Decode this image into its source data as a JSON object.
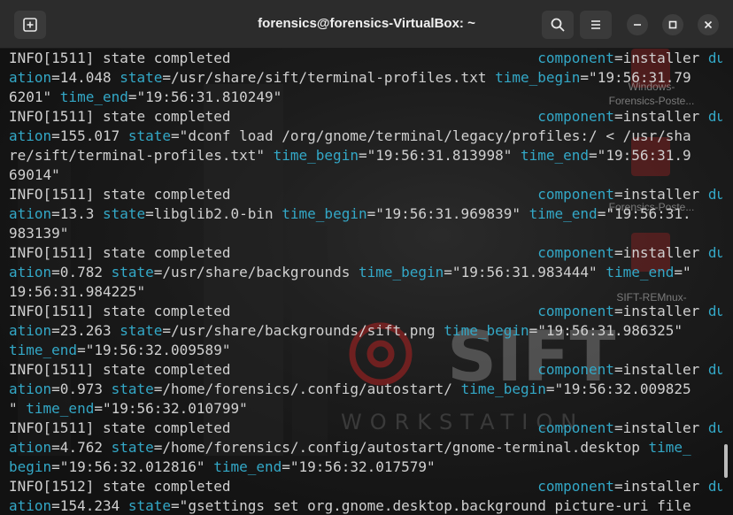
{
  "window": {
    "title": "forensics@forensics-VirtualBox: ~",
    "new_tab_icon": "new-tab-icon",
    "search_icon": "search-icon",
    "menu_icon": "hamburger-menu-icon",
    "minimize_icon": "minimize-icon",
    "maximize_icon": "maximize-icon",
    "close_icon": "close-icon"
  },
  "desktop": {
    "logo_text": "SIFT",
    "logo_subtext": "WORKSTATION",
    "icons": [
      {
        "label": "Windows-"
      },
      {
        "label": "Forensics-Poste..."
      },
      {
        "label": "Forensics-Poste..."
      },
      {
        "label": "SIFT-REMnux-"
      }
    ]
  },
  "colors": {
    "key": "#33a8c7",
    "text": "#d0d0d0",
    "titlebar": "#2c2c2c"
  },
  "terminal": {
    "lines": [
      {
        "segs": [
          [
            "s",
            "INFO[1511] state completed                                    "
          ],
          [
            "c",
            "component"
          ],
          [
            "s",
            "=installer "
          ],
          [
            "c",
            "dur"
          ]
        ]
      },
      {
        "segs": [
          [
            "c",
            "ation"
          ],
          [
            "s",
            "=14.048 "
          ],
          [
            "c",
            "state"
          ],
          [
            "s",
            "=/usr/share/sift/terminal-profiles.txt "
          ],
          [
            "c",
            "time_begin"
          ],
          [
            "s",
            "=\"19:56:31.79"
          ]
        ]
      },
      {
        "segs": [
          [
            "s",
            "6201\" "
          ],
          [
            "c",
            "time_end"
          ],
          [
            "s",
            "=\"19:56:31.810249\""
          ]
        ]
      },
      {
        "segs": [
          [
            "s",
            "INFO[1511] state completed                                    "
          ],
          [
            "c",
            "component"
          ],
          [
            "s",
            "=installer "
          ],
          [
            "c",
            "dur"
          ]
        ]
      },
      {
        "segs": [
          [
            "c",
            "ation"
          ],
          [
            "s",
            "=155.017 "
          ],
          [
            "c",
            "state"
          ],
          [
            "s",
            "=\"dconf load /org/gnome/terminal/legacy/profiles:/ < /usr/sha"
          ]
        ]
      },
      {
        "segs": [
          [
            "s",
            "re/sift/terminal-profiles.txt\" "
          ],
          [
            "c",
            "time_begin"
          ],
          [
            "s",
            "=\"19:56:31.813998\" "
          ],
          [
            "c",
            "time_end"
          ],
          [
            "s",
            "=\"19:56:31.9"
          ]
        ]
      },
      {
        "segs": [
          [
            "s",
            "69014\""
          ]
        ]
      },
      {
        "segs": [
          [
            "s",
            "INFO[1511] state completed                                    "
          ],
          [
            "c",
            "component"
          ],
          [
            "s",
            "=installer "
          ],
          [
            "c",
            "dur"
          ]
        ]
      },
      {
        "segs": [
          [
            "c",
            "ation"
          ],
          [
            "s",
            "=13.3 "
          ],
          [
            "c",
            "state"
          ],
          [
            "s",
            "=libglib2.0-bin "
          ],
          [
            "c",
            "time_begin"
          ],
          [
            "s",
            "=\"19:56:31.969839\" "
          ],
          [
            "c",
            "time_end"
          ],
          [
            "s",
            "=\"19:56:31."
          ]
        ]
      },
      {
        "segs": [
          [
            "s",
            "983139\""
          ]
        ]
      },
      {
        "segs": [
          [
            "s",
            "INFO[1511] state completed                                    "
          ],
          [
            "c",
            "component"
          ],
          [
            "s",
            "=installer "
          ],
          [
            "c",
            "dur"
          ]
        ]
      },
      {
        "segs": [
          [
            "c",
            "ation"
          ],
          [
            "s",
            "=0.782 "
          ],
          [
            "c",
            "state"
          ],
          [
            "s",
            "=/usr/share/backgrounds "
          ],
          [
            "c",
            "time_begin"
          ],
          [
            "s",
            "=\"19:56:31.983444\" "
          ],
          [
            "c",
            "time_end"
          ],
          [
            "s",
            "=\""
          ]
        ]
      },
      {
        "segs": [
          [
            "s",
            "19:56:31.984225\""
          ]
        ]
      },
      {
        "segs": [
          [
            "s",
            "INFO[1511] state completed                                    "
          ],
          [
            "c",
            "component"
          ],
          [
            "s",
            "=installer "
          ],
          [
            "c",
            "dur"
          ]
        ]
      },
      {
        "segs": [
          [
            "c",
            "ation"
          ],
          [
            "s",
            "=23.263 "
          ],
          [
            "c",
            "state"
          ],
          [
            "s",
            "=/usr/share/backgrounds/sift.png "
          ],
          [
            "c",
            "time_begin"
          ],
          [
            "s",
            "=\"19:56:31.986325\""
          ]
        ]
      },
      {
        "segs": [
          [
            "c",
            "time_end"
          ],
          [
            "s",
            "=\"19:56:32.009589\""
          ]
        ]
      },
      {
        "segs": [
          [
            "s",
            "INFO[1511] state completed                                    "
          ],
          [
            "c",
            "component"
          ],
          [
            "s",
            "=installer "
          ],
          [
            "c",
            "dur"
          ]
        ]
      },
      {
        "segs": [
          [
            "c",
            "ation"
          ],
          [
            "s",
            "=0.973 "
          ],
          [
            "c",
            "state"
          ],
          [
            "s",
            "=/home/forensics/.config/autostart/ "
          ],
          [
            "c",
            "time_begin"
          ],
          [
            "s",
            "=\"19:56:32.009825"
          ]
        ]
      },
      {
        "segs": [
          [
            "s",
            "\" "
          ],
          [
            "c",
            "time_end"
          ],
          [
            "s",
            "=\"19:56:32.010799\""
          ]
        ]
      },
      {
        "segs": [
          [
            "s",
            "INFO[1511] state completed                                    "
          ],
          [
            "c",
            "component"
          ],
          [
            "s",
            "=installer "
          ],
          [
            "c",
            "dur"
          ]
        ]
      },
      {
        "segs": [
          [
            "c",
            "ation"
          ],
          [
            "s",
            "=4.762 "
          ],
          [
            "c",
            "state"
          ],
          [
            "s",
            "=/home/forensics/.config/autostart/gnome-terminal.desktop "
          ],
          [
            "c",
            "time_"
          ]
        ]
      },
      {
        "segs": [
          [
            "c",
            "begin"
          ],
          [
            "s",
            "=\"19:56:32.012816\" "
          ],
          [
            "c",
            "time_end"
          ],
          [
            "s",
            "=\"19:56:32.017579\""
          ]
        ]
      },
      {
        "segs": [
          [
            "s",
            "INFO[1512] state completed                                    "
          ],
          [
            "c",
            "component"
          ],
          [
            "s",
            "=installer "
          ],
          [
            "c",
            "dur"
          ]
        ]
      },
      {
        "segs": [
          [
            "c",
            "ation"
          ],
          [
            "s",
            "=154.234 "
          ],
          [
            "c",
            "state"
          ],
          [
            "s",
            "=\"gsettings set org.gnome.desktop.background picture-uri file"
          ]
        ]
      }
    ]
  }
}
